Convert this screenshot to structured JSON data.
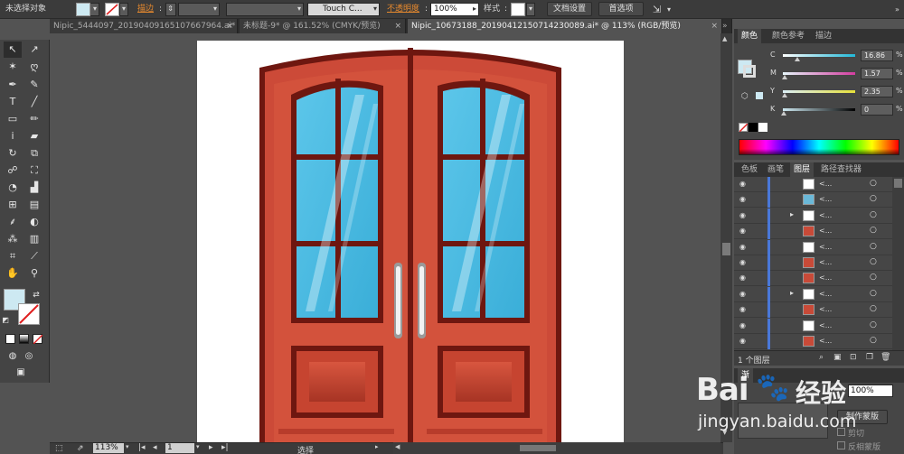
{
  "control_bar": {
    "selection_label": "未选择对象",
    "stroke_label": "描边",
    "brush_label": "Touch C...",
    "opacity_label": "不透明度",
    "opacity_value": "100%",
    "style_label": "样式",
    "doc_setup_button": "文档设置",
    "prefs_button": "首选项"
  },
  "tabs": [
    {
      "label": "Nipic_5444097_20190409165107667964.ai*",
      "close": "×"
    },
    {
      "label": "未标题-9* @ 161.52% (CMYK/预览)",
      "close": "×"
    },
    {
      "label": "Nipic_10673188_20190412150714230089.ai* @ 113% (RGB/预览)",
      "close": "×"
    }
  ],
  "color_panel": {
    "tabs": [
      "颜色",
      "颜色参考",
      "描边"
    ],
    "channels": [
      {
        "name": "C",
        "value": "16.86",
        "fraction": 0.17,
        "color": "#22b8d8"
      },
      {
        "name": "M",
        "value": "1.57",
        "fraction": 0.02,
        "color": "#d43ca0"
      },
      {
        "name": "Y",
        "value": "2.35",
        "fraction": 0.02,
        "color": "#e6e03a"
      },
      {
        "name": "K",
        "value": "0",
        "fraction": 0.0,
        "color": "#aaaaaa"
      }
    ],
    "percent_sign": "%"
  },
  "layers_panel": {
    "tabs": [
      "色板",
      "画笔",
      "图层",
      "路径查找器"
    ],
    "layer_name": "<...",
    "footer_count": "1 个图层"
  },
  "transparency_panel": {
    "tab": "渐",
    "opacity_value": "100%",
    "make_mask_button": "制作蒙版",
    "clip_label": "剪切",
    "invert_label": "反相蒙版"
  },
  "status_bar": {
    "zoom": "113%",
    "page": "1",
    "mode": "选择"
  },
  "watermark": {
    "brand": "Bai",
    "brand_cn": "经验",
    "url": "jingyan.baidu.com"
  },
  "colors": {
    "fill": "#cde9f2",
    "door_red": "#cc4a38",
    "door_dark": "#6e1710",
    "glass": "#4ab9e0"
  }
}
